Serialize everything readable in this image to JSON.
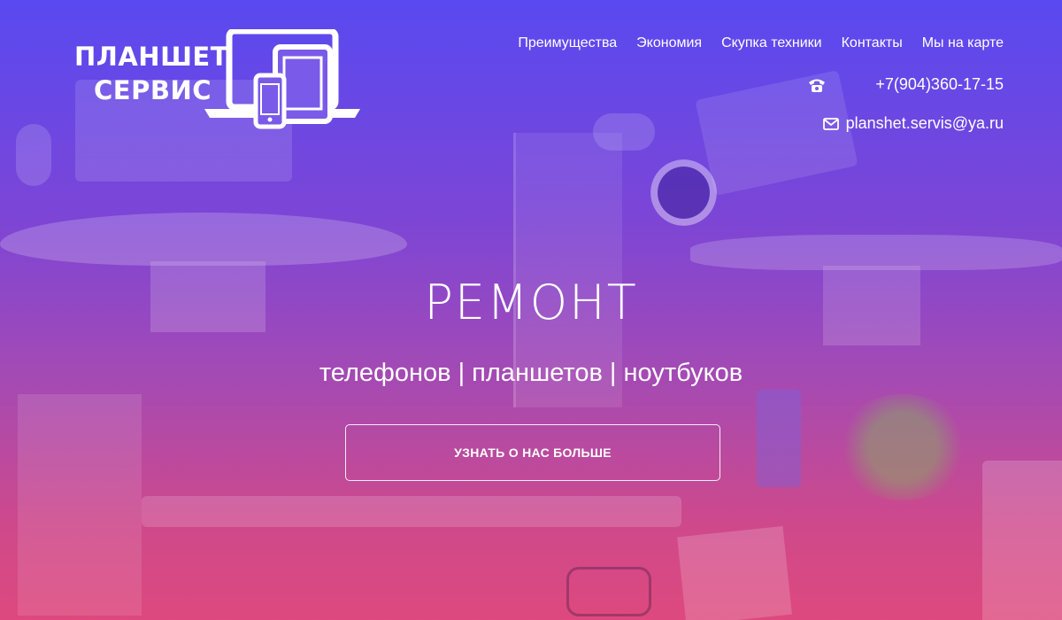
{
  "logo": {
    "line1": "ПЛАНШЕТ",
    "line2": "СЕРВИС",
    "icon": "devices-icon"
  },
  "nav": {
    "items": [
      {
        "label": "Преимущества"
      },
      {
        "label": "Экономия"
      },
      {
        "label": "Скупка техники"
      },
      {
        "label": "Контакты"
      },
      {
        "label": "Мы на карте"
      }
    ]
  },
  "contacts": {
    "phone": "+7(904)360-17-15",
    "phone_icon": "phone-icon",
    "email": "planshet.servis@ya.ru",
    "email_icon": "mail-icon"
  },
  "hero": {
    "title": "РЕМОНТ",
    "subtitle": "телефонов | планшетов | ноутбуков",
    "cta_label": "УЗНАТЬ О НАС БОЛЬШЕ"
  },
  "colors": {
    "gradient_top": "#5a4bf0",
    "gradient_bottom": "#de4a80",
    "text": "#ffffff"
  }
}
